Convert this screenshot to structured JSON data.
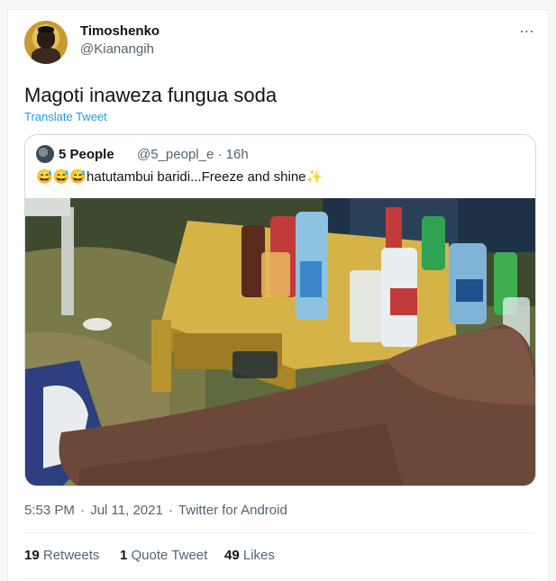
{
  "tweet": {
    "author_name": "Timoshenko",
    "author_handle": "@Kianangih",
    "more_icon": "⋯",
    "text": "Magoti inaweza fungua soda",
    "translate_label": "Translate Tweet",
    "time": "5:53 PM",
    "date": "Jul 11, 2021",
    "source": "Twitter for Android",
    "separator": "·"
  },
  "quoted": {
    "author_name": "5 People",
    "author_handle": "@5_peopl_e",
    "age": "16h",
    "separator": "·",
    "emoji": "😅😅😅",
    "text": "hatutambui baridi...Freeze and shine",
    "sparkle": "✨"
  },
  "stats": {
    "retweets_count": "19",
    "retweets_label": "Retweets",
    "quote_count": "1",
    "quote_label": "Quote Tweet",
    "likes_count": "49",
    "likes_label": "Likes"
  },
  "colors": {
    "accent": "#1d9bf0",
    "secondary_text": "#536471",
    "border": "#cfd9de"
  }
}
